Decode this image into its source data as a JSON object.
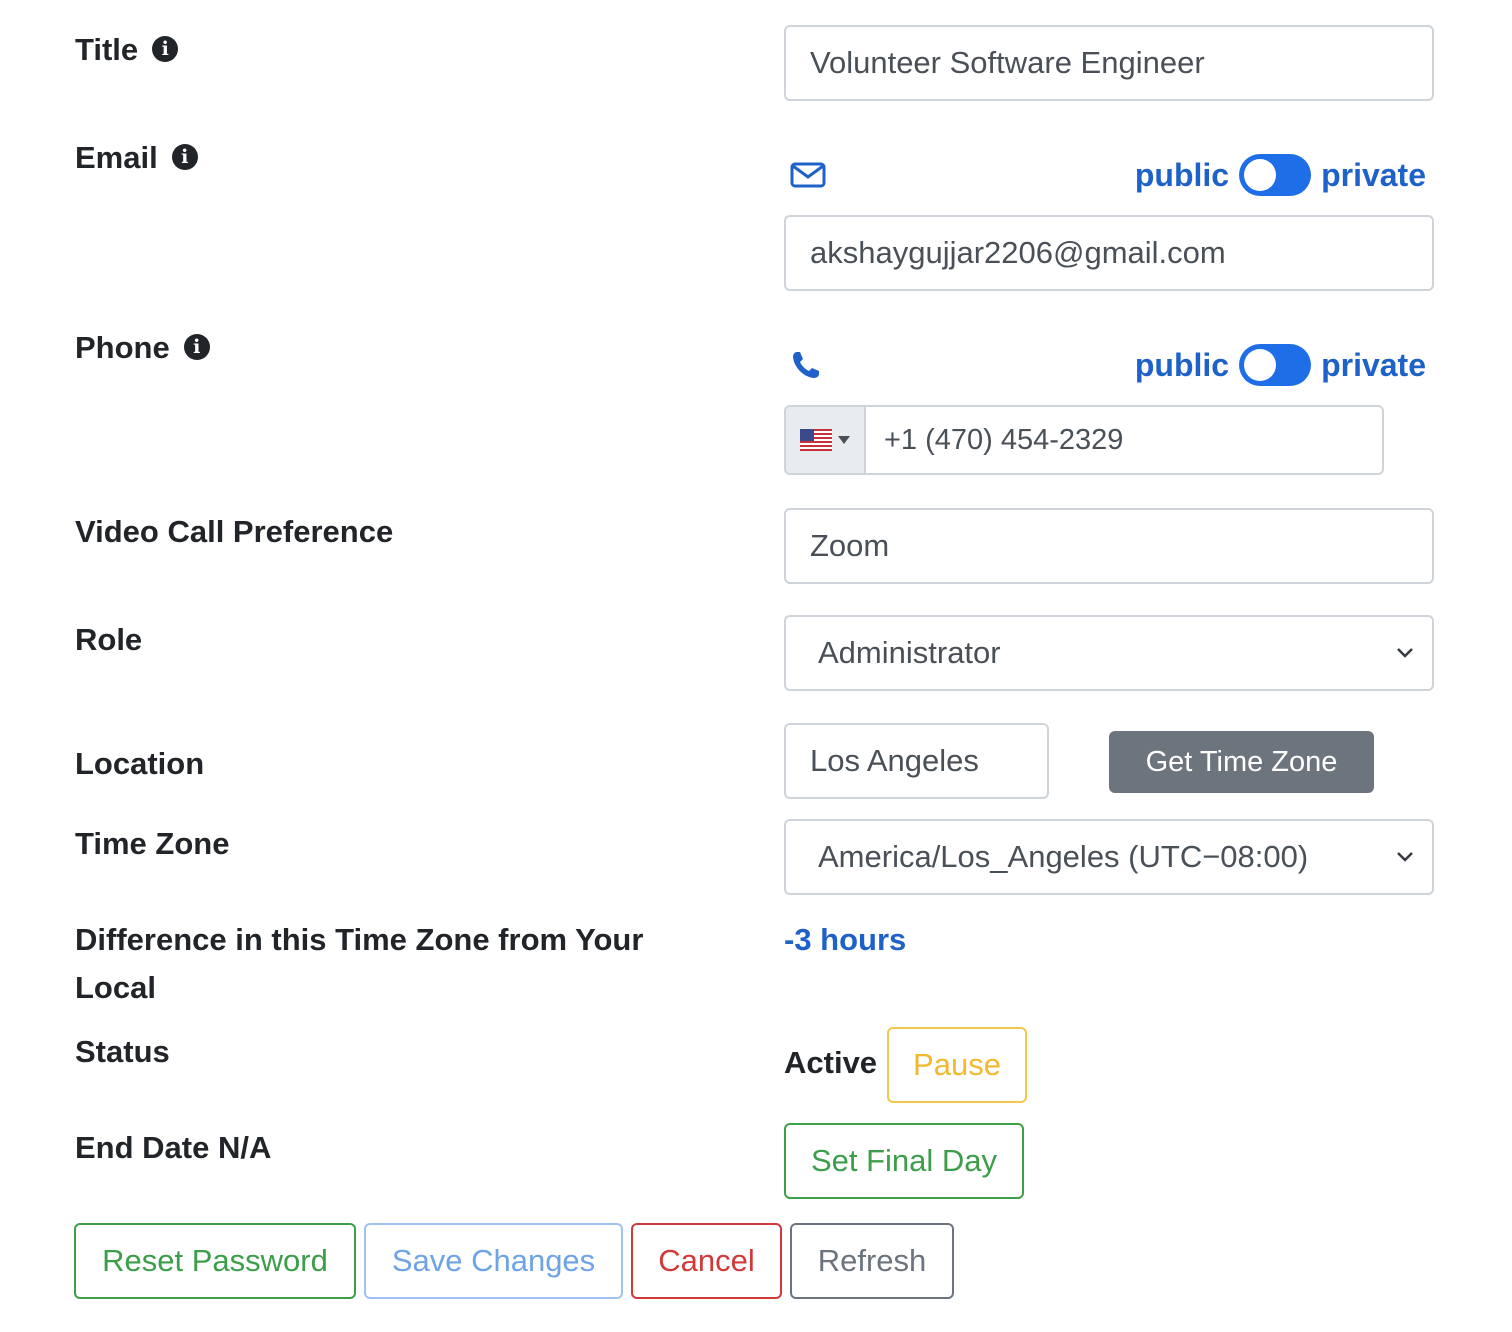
{
  "fields": {
    "title": {
      "label": "Title",
      "value": "Volunteer Software Engineer"
    },
    "email": {
      "label": "Email",
      "value": "akshaygujjar2206@gmail.com",
      "toggle_public": "public",
      "toggle_private": "private"
    },
    "phone": {
      "label": "Phone",
      "value": "+1 (470) 454-2329",
      "toggle_public": "public",
      "toggle_private": "private"
    },
    "video": {
      "label": "Video Call Preference",
      "value": "Zoom"
    },
    "role": {
      "label": "Role",
      "value": "Administrator"
    },
    "location": {
      "label": "Location",
      "value": "Los Angeles",
      "button": "Get Time Zone"
    },
    "timezone": {
      "label": "Time Zone",
      "value": "America/Los_Angeles (UTC−08:00)"
    },
    "difference": {
      "label": "Difference in this Time Zone from Your Local",
      "value": "-3 hours"
    },
    "status": {
      "label": "Status",
      "value": "Active",
      "button": "Pause"
    },
    "end_date": {
      "label": "End Date N/A",
      "button": "Set Final Day"
    }
  },
  "actions": {
    "reset": "Reset Password",
    "save": "Save Changes",
    "cancel": "Cancel",
    "refresh": "Refresh"
  },
  "icons": {
    "info": "info-circle-icon",
    "email": "envelope-icon",
    "phone": "phone-icon",
    "flag": "us-flag-icon",
    "chevron": "chevron-down-icon"
  },
  "colors": {
    "link_blue": "#1e62c9",
    "toggle_blue": "#1e6ee8",
    "success": "#3d9e4a",
    "danger": "#d03a3a",
    "warning": "#f2b92e",
    "secondary": "#6c757d"
  }
}
